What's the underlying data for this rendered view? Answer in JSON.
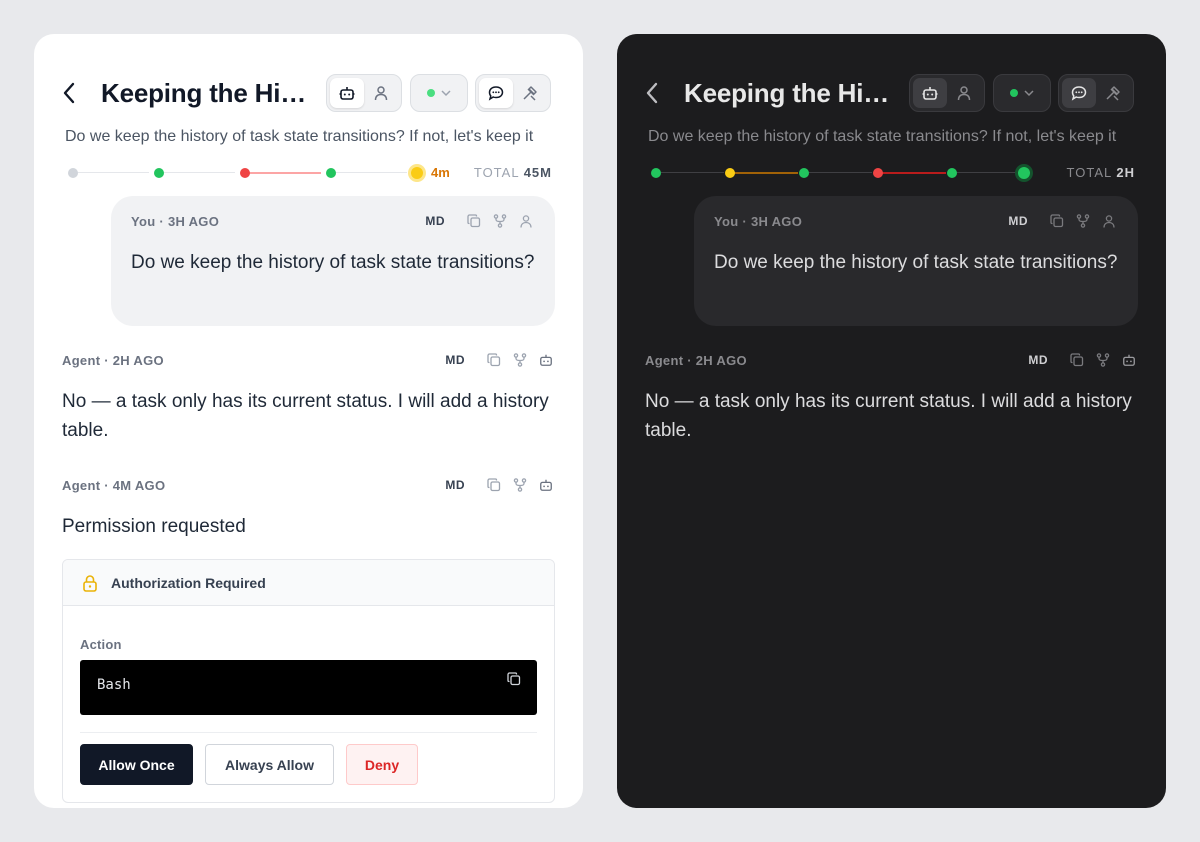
{
  "light": {
    "title": "Keeping the History of Task State Transitions",
    "subtitle": "Do we keep the history of task state transitions? If not, let's keep it",
    "timeline": {
      "active_label": "4m",
      "total_label": "TOTAL",
      "total_value": "45M"
    },
    "user_message": {
      "who": "You · 3H AGO",
      "md": "MD",
      "text": "Do we keep the history of task state transitions?"
    },
    "agent_messages": [
      {
        "who": "Agent · 2H AGO",
        "md": "MD",
        "text": "No — a task only has its current status. I will add a history table."
      },
      {
        "who": "Agent · 4M AGO",
        "md": "MD",
        "text": "Permission requested"
      }
    ],
    "auth": {
      "title": "Authorization Required",
      "action_label": "Action",
      "command": "Bash",
      "allow_once": "Allow Once",
      "always_allow": "Always Allow",
      "deny": "Deny"
    }
  },
  "dark": {
    "title": "Keeping the History of Task State Transitions",
    "subtitle": "Do we keep the history of task state transitions? If not, let's keep it",
    "timeline": {
      "total_label": "TOTAL",
      "total_value": "2H"
    },
    "user_message": {
      "who": "You · 3H AGO",
      "md": "MD",
      "text": "Do we keep the history of task state transitions?"
    },
    "agent_messages": [
      {
        "who": "Agent · 2H AGO",
        "md": "MD",
        "text": "No — a task only has its current status. I will add a history table."
      }
    ]
  },
  "colors": {
    "green": "#22c55e",
    "red": "#ef4444",
    "yellow": "#facc15",
    "gray": "#d1d5db"
  },
  "icons": [
    "chevron-left-icon",
    "robot-icon",
    "user-icon",
    "chevron-down-icon",
    "chat-icon",
    "tools-icon",
    "copy-icon",
    "branch-icon",
    "lock-icon"
  ]
}
